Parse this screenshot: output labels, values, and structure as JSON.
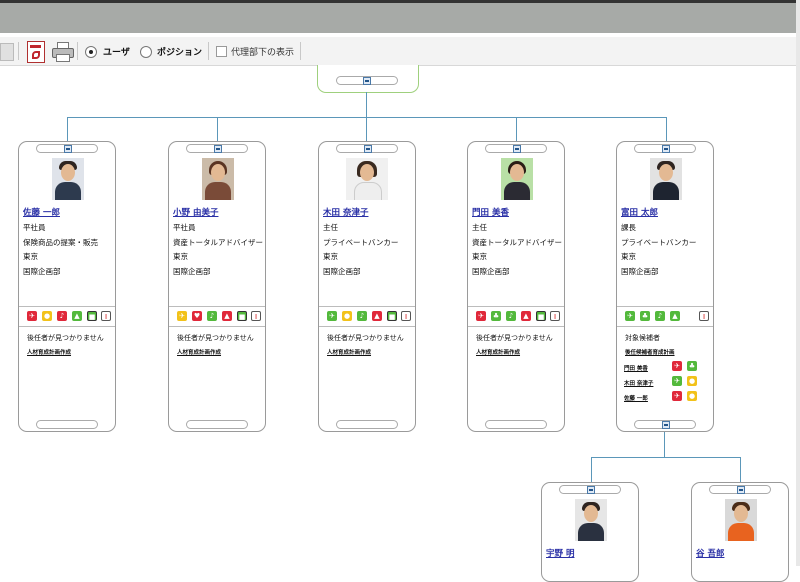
{
  "toolbar": {
    "mode_user": "ユーザ",
    "mode_position": "ポジション",
    "proxy_label": "代理部下の表示"
  },
  "cards": [
    {
      "name": "佐藤 一郎",
      "title": "平社員",
      "role": "保険商品の提案・販売",
      "location": "東京",
      "dept": "国際企画部",
      "note": "後任者が見つかりません",
      "sub": "人材育成計画作成",
      "icons": [
        "red",
        "yellow",
        "red",
        "green",
        "green",
        "white"
      ]
    },
    {
      "name": "小野 由美子",
      "title": "平社員",
      "role": "資産トータルアドバイザー",
      "location": "東京",
      "dept": "国際企画部",
      "note": "後任者が見つかりません",
      "sub": "人材育成計画作成",
      "icons": [
        "yellow",
        "red",
        "green",
        "red",
        "green",
        "white"
      ]
    },
    {
      "name": "木田 奈津子",
      "title": "主任",
      "role": "プライベートバンカー",
      "location": "東京",
      "dept": "国際企画部",
      "note": "後任者が見つかりません",
      "sub": "人材育成計画作成",
      "icons": [
        "green",
        "yellow",
        "green",
        "red",
        "green",
        "white"
      ]
    },
    {
      "name": "門田 美香",
      "title": "主任",
      "role": "資産トータルアドバイザー",
      "location": "東京",
      "dept": "国際企画部",
      "note": "後任者が見つかりません",
      "sub": "人材育成計画作成",
      "icons": [
        "red",
        "green",
        "green",
        "red",
        "green",
        "white"
      ]
    },
    {
      "name": "富田 太郎",
      "title": "課長",
      "role": "プライベートバンカー",
      "location": "東京",
      "dept": "国際企画部",
      "note": "対象候補者",
      "sub": "後任候補者育成計画",
      "icons": [
        "green",
        "green",
        "green",
        "green",
        "white"
      ],
      "candidates": [
        {
          "name": "門田 美香",
          "icons": [
            "red",
            "green"
          ]
        },
        {
          "name": "木田 奈津子",
          "icons": [
            "green",
            "yellow"
          ]
        },
        {
          "name": "佐藤 一郎",
          "icons": [
            "red",
            "yellow"
          ]
        }
      ]
    }
  ],
  "sub_cards": [
    {
      "name": "宇野 明"
    },
    {
      "name": "谷 吾郎"
    }
  ],
  "colors": {
    "connector": "#5b97b9",
    "link": "#2a30a6",
    "red": "#e0283a",
    "yellow": "#f2c21a",
    "green": "#53b93c"
  }
}
